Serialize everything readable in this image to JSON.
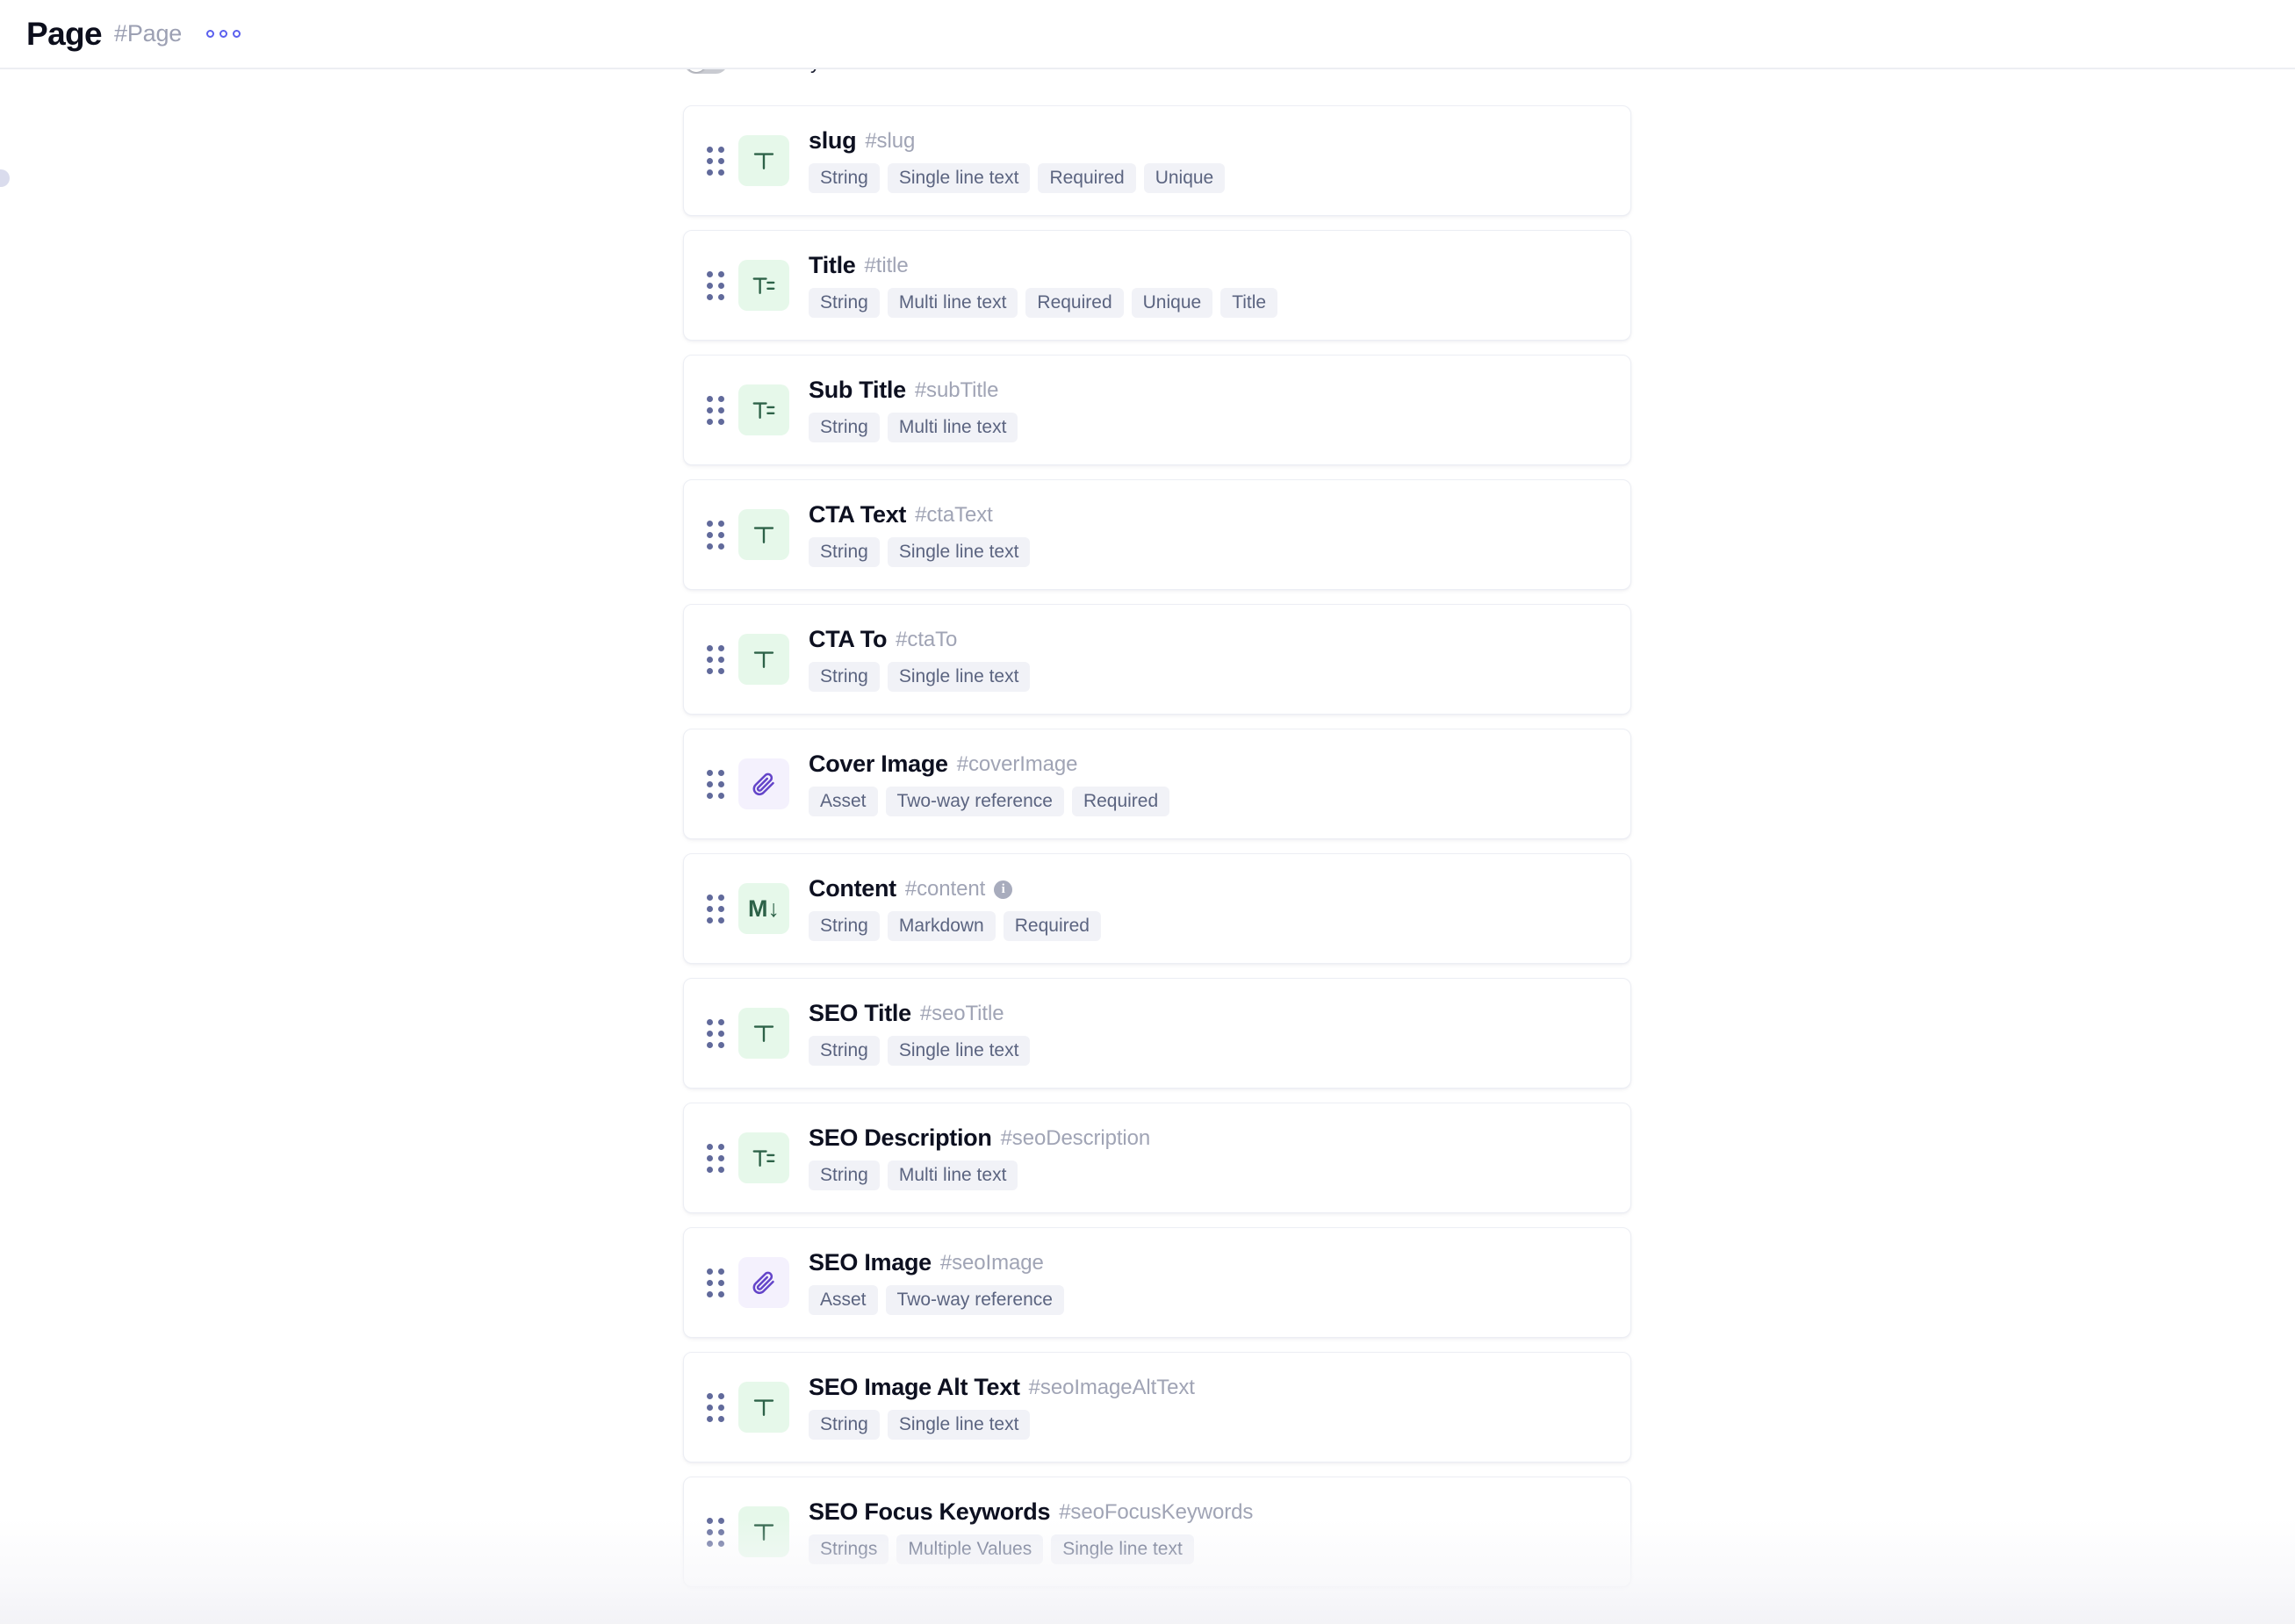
{
  "header": {
    "title": "Page",
    "slug": "#Page",
    "more_menu": "more-options"
  },
  "system_fields_toggle": {
    "label": "Show system fields",
    "enabled": false
  },
  "fields": [
    {
      "name": "slug",
      "key": "#slug",
      "icon": "single-line-text-icon",
      "icon_glyph": "T",
      "icon_color": "green",
      "has_info": false,
      "tags": [
        "String",
        "Single line text",
        "Required",
        "Unique"
      ]
    },
    {
      "name": "Title",
      "key": "#title",
      "icon": "multi-line-text-icon",
      "icon_glyph": "T-lines",
      "icon_color": "green",
      "has_info": false,
      "tags": [
        "String",
        "Multi line text",
        "Required",
        "Unique",
        "Title"
      ]
    },
    {
      "name": "Sub Title",
      "key": "#subTitle",
      "icon": "multi-line-text-icon",
      "icon_glyph": "T-lines",
      "icon_color": "green",
      "has_info": false,
      "tags": [
        "String",
        "Multi line text"
      ]
    },
    {
      "name": "CTA Text",
      "key": "#ctaText",
      "icon": "single-line-text-icon",
      "icon_glyph": "T",
      "icon_color": "green",
      "has_info": false,
      "tags": [
        "String",
        "Single line text"
      ]
    },
    {
      "name": "CTA To",
      "key": "#ctaTo",
      "icon": "single-line-text-icon",
      "icon_glyph": "T",
      "icon_color": "green",
      "has_info": false,
      "tags": [
        "String",
        "Single line text"
      ]
    },
    {
      "name": "Cover Image",
      "key": "#coverImage",
      "icon": "paperclip-asset-icon",
      "icon_glyph": "paperclip",
      "icon_color": "purple",
      "has_info": false,
      "tags": [
        "Asset",
        "Two-way reference",
        "Required"
      ]
    },
    {
      "name": "Content",
      "key": "#content",
      "icon": "markdown-icon",
      "icon_glyph": "M↓",
      "icon_color": "green",
      "has_info": true,
      "info_label": "i",
      "tags": [
        "String",
        "Markdown",
        "Required"
      ]
    },
    {
      "name": "SEO Title",
      "key": "#seoTitle",
      "icon": "single-line-text-icon",
      "icon_glyph": "T",
      "icon_color": "green",
      "has_info": false,
      "tags": [
        "String",
        "Single line text"
      ]
    },
    {
      "name": "SEO Description",
      "key": "#seoDescription",
      "icon": "multi-line-text-icon",
      "icon_glyph": "T-lines",
      "icon_color": "green",
      "has_info": false,
      "tags": [
        "String",
        "Multi line text"
      ]
    },
    {
      "name": "SEO Image",
      "key": "#seoImage",
      "icon": "paperclip-asset-icon",
      "icon_glyph": "paperclip",
      "icon_color": "purple",
      "has_info": false,
      "tags": [
        "Asset",
        "Two-way reference"
      ]
    },
    {
      "name": "SEO Image Alt Text",
      "key": "#seoImageAltText",
      "icon": "single-line-text-icon",
      "icon_glyph": "T",
      "icon_color": "green",
      "has_info": false,
      "tags": [
        "String",
        "Single line text"
      ]
    },
    {
      "name": "SEO Focus Keywords",
      "key": "#seoFocusKeywords",
      "icon": "single-line-text-icon",
      "icon_glyph": "T",
      "icon_color": "green",
      "has_info": false,
      "tags": [
        "Strings",
        "Multiple Values",
        "Single line text"
      ]
    }
  ],
  "colors": {
    "accent": "#5b60ee",
    "tile_green_bg": "#e6f8ea",
    "tile_green_fg": "#2d6248",
    "tile_purple_bg": "#f4f1fd",
    "tile_purple_fg": "#6344c9",
    "tag_bg": "#f1f2f7",
    "tag_fg": "#5b6480"
  }
}
